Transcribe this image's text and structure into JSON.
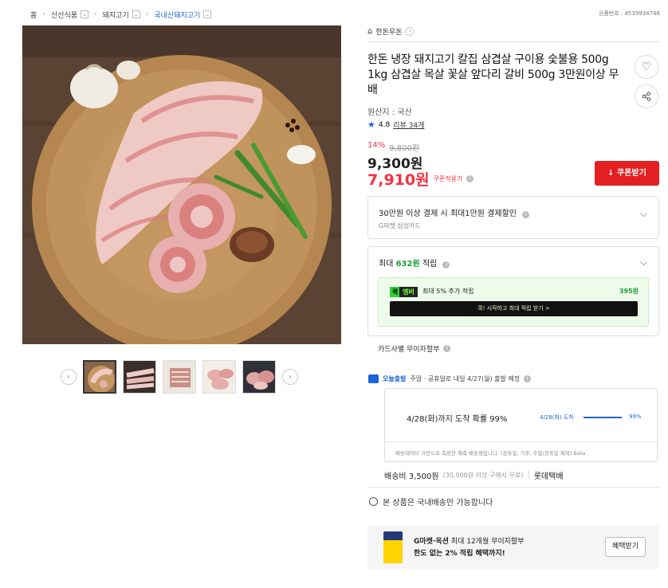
{
  "breadcrumb": {
    "items": [
      "홈",
      "신선식품",
      "돼지고기",
      "국내산돼지고기"
    ],
    "dropdown_icon": "chevron-down-icon"
  },
  "product_number": "상품번호 : 4539934746",
  "gallery": {
    "thumbnail_count": 5,
    "selected_index": 0,
    "prev_icon": "chevron-left-icon",
    "next_icon": "chevron-right-icon"
  },
  "brand": {
    "name": "한돈우돈",
    "icon": "home-icon"
  },
  "title": "한돈 냉장 돼지고기 칼집 삼겹살 구이용 숯불용 500g 1kg 삼겹살 목살 꽃살 앞다리 갈비 500g 3만원이상 무배",
  "origin": "원산지 : 국산",
  "rating": {
    "score": "4.8",
    "reviews": "리뷰 34개"
  },
  "price": {
    "discount_pct": "14%",
    "original": "9,800원",
    "sale": "9,300원",
    "coupon_price": "7,910원",
    "coupon_label": "쿠폰적용가"
  },
  "coupon_button": "쿠폰받기",
  "card_benefit": {
    "title": "30만원 이상 결제 시 최대1만원 결제할인",
    "subtitle": "G마켓 삼성카드"
  },
  "points": {
    "prefix": "최대 ",
    "amount": "632원",
    "suffix": " 적립",
    "member_badge_1": "쿡",
    "member_badge_2": "멤버",
    "member_text": "최대 5% 추가 적립",
    "member_value": "395원",
    "member_cta": "쿡! 시작하고 최대 적립 받기 >"
  },
  "installment": "카드사별 무이자할부",
  "shipping": {
    "tag": "오늘출발",
    "text": "주말 · 공휴일로 내일 4/27(월) 출발 예정",
    "eta": "4/28(화)까지 도착 확률 99%",
    "eta_small": "4/28(화) 도착",
    "eta_pct": "99%",
    "eta_progress": 0.99,
    "note": "배송데이터 기반으로 측정한 예측 배송정입니다. (공휴일, 기후, 주말/공휴일 제외) Beta",
    "fee": "배송비 3,500원",
    "fee_note": "(30,000원 이상 구매시 무료)",
    "carrier": "롯데택배"
  },
  "domestic": "본 상품은 국내배송만 가능합니다",
  "promo": {
    "brand": "G마켓·옥션",
    "line1": " 최대 12개월 무이자할부",
    "line2": "한도 없는 2% 적립 혜택까지!",
    "button": "혜택받기"
  },
  "colors": {
    "accent_red": "#f43142",
    "coupon_red": "#e41f1f",
    "link_blue": "#1a66d8",
    "points_green": "#1c9d38"
  }
}
